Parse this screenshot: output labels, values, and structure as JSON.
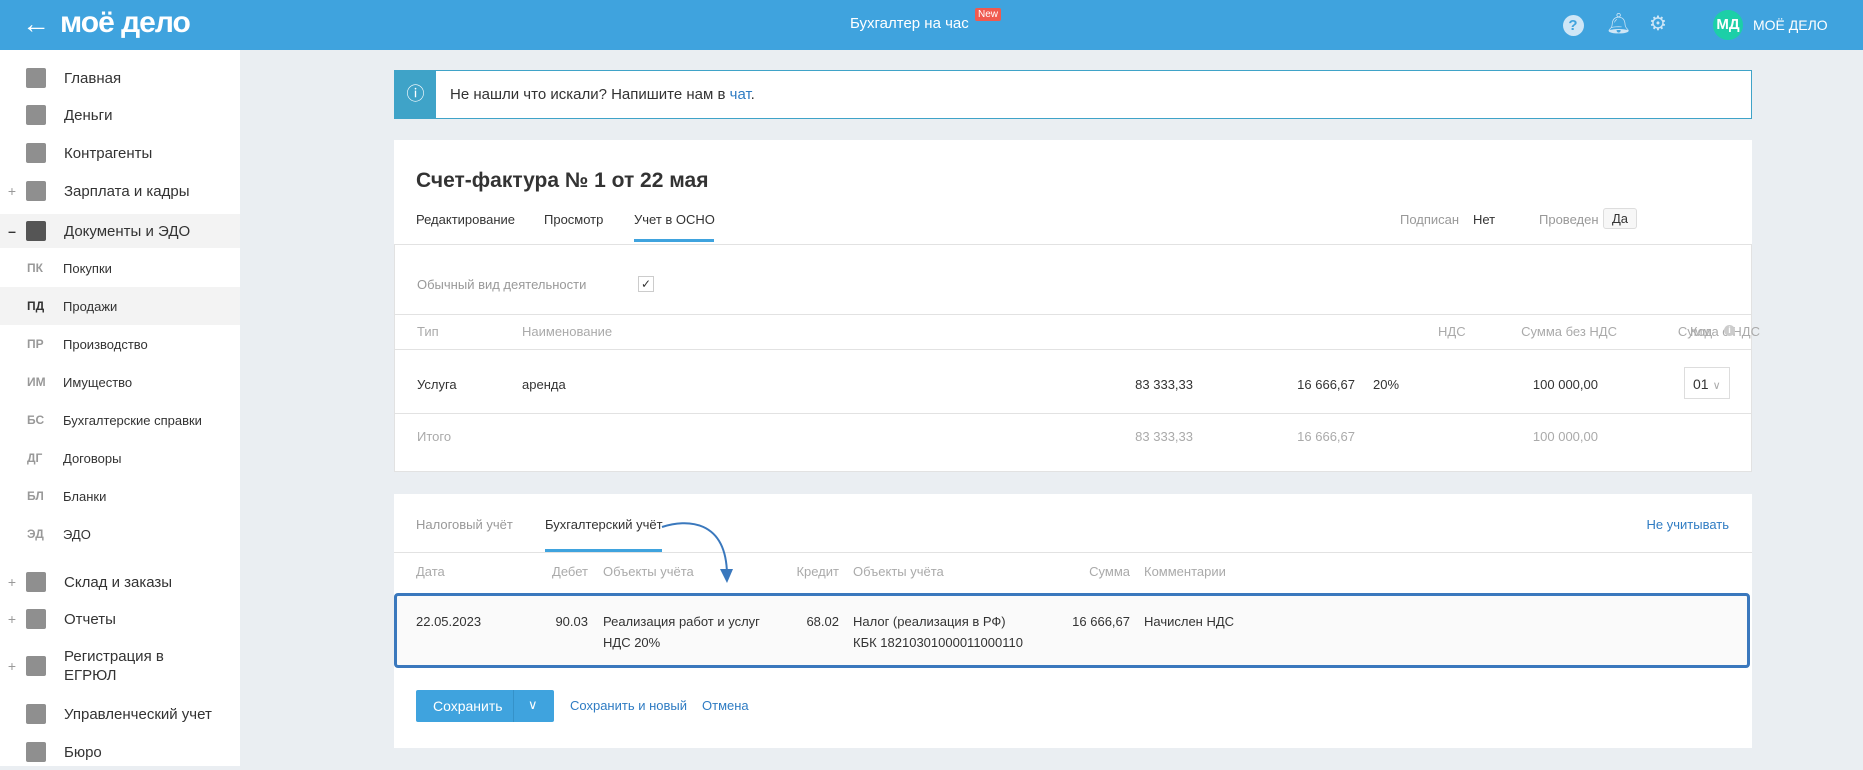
{
  "header": {
    "logo": "моё дело",
    "title": "Бухгалтер на час",
    "badge": "New",
    "user_initials": "МД",
    "user_name": "МОЁ ДЕЛО"
  },
  "sidebar": {
    "items": [
      {
        "label": "Главная",
        "icon": "home-icon"
      },
      {
        "label": "Деньги",
        "icon": "money-icon"
      },
      {
        "label": "Контрагенты",
        "icon": "contractors-icon"
      },
      {
        "label": "Зарплата и кадры",
        "icon": "salary-icon",
        "prefix": "+"
      },
      {
        "label": "Документы и ЭДО",
        "icon": "folder-icon",
        "prefix": "–"
      }
    ],
    "sub": [
      {
        "abbr": "ПК",
        "label": "Покупки"
      },
      {
        "abbr": "ПД",
        "label": "Продажи"
      },
      {
        "abbr": "ПР",
        "label": "Производство"
      },
      {
        "abbr": "ИМ",
        "label": "Имущество"
      },
      {
        "abbr": "БС",
        "label": "Бухгалтерские справки"
      },
      {
        "abbr": "ДГ",
        "label": "Договоры"
      },
      {
        "abbr": "БЛ",
        "label": "Бланки"
      },
      {
        "abbr": "ЭД",
        "label": "ЭДО"
      }
    ],
    "bottom": [
      {
        "label": "Склад и заказы",
        "prefix": "+"
      },
      {
        "label": "Отчеты",
        "prefix": "+"
      },
      {
        "label": "Регистрация в ЕГРЮЛ",
        "prefix": "+"
      },
      {
        "label": "Управленческий учет",
        "prefix": ""
      },
      {
        "label": "Бюро",
        "prefix": ""
      }
    ]
  },
  "info": {
    "text": "Не нашли что искали? Напишите нам в ",
    "link": "чат",
    "end": "."
  },
  "doc": {
    "title": "Счет-фактура № 1 от 22 мая",
    "tabs": [
      "Редактирование",
      "Просмотр",
      "Учет в ОСНО"
    ],
    "signed_label": "Подписан",
    "signed_value": "Нет",
    "posted_label": "Проведен",
    "posted_value": "Да",
    "activity_label": "Обычный вид деятельности",
    "activity_checked": true,
    "columns": [
      "Тип",
      "Наименование",
      "Сумма без НДС",
      "НДС",
      "Сумма с НДС",
      "Код"
    ],
    "row": {
      "type": "Услуга",
      "name": "аренда",
      "sum": "83 333,33",
      "vat": "16 666,67",
      "rate": "20%",
      "total": "100 000,00",
      "code": "01"
    },
    "totals": {
      "label": "Итого",
      "sum": "83 333,33",
      "vat": "16 666,67",
      "total": "100 000,00"
    }
  },
  "accounting": {
    "tabs": [
      "Налоговый учёт",
      "Бухгалтерский учёт"
    ],
    "exclude": "Не учитывать",
    "columns": [
      "Дата",
      "Дебет",
      "Объекты учёта",
      "Кредит",
      "Объекты учёта",
      "Сумма",
      "Комментарии"
    ],
    "row": {
      "date": "22.05.2023",
      "debit": "90.03",
      "debit_obj1": "Реализация работ и услуг",
      "debit_obj2": "НДС 20%",
      "credit": "68.02",
      "credit_obj1": "Налог (реализация в РФ)",
      "credit_obj2": "КБК 18210301000011000110",
      "sum": "16 666,67",
      "comment": "Начислен НДС"
    }
  },
  "actions": {
    "save": "Сохранить",
    "save_new": "Сохранить и новый",
    "cancel": "Отмена"
  }
}
